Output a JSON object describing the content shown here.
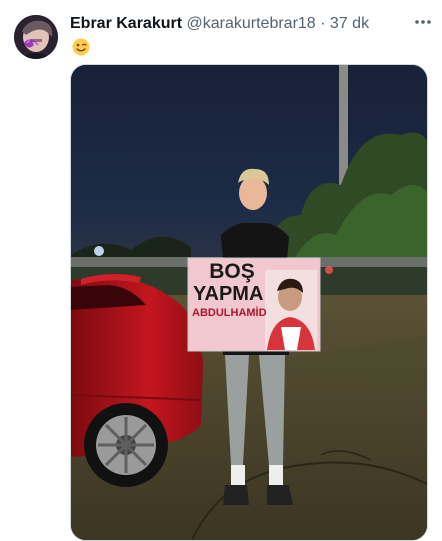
{
  "tweet": {
    "author_name": "Ebrar Karakurt",
    "handle": "@karakurtebrar18",
    "separator": "·",
    "time": "37 dk",
    "more_icon": "ellipsis-icon",
    "emoji": "winking-face-emoji"
  },
  "photo": {
    "sign": {
      "line1": "BOŞ",
      "line2": "YAPMA",
      "line3": "ABDULHAMİD"
    }
  },
  "colors": {
    "sign_background": "#f2c8d0",
    "car_red": "#b1121b",
    "night_sky": "#1b2740"
  }
}
